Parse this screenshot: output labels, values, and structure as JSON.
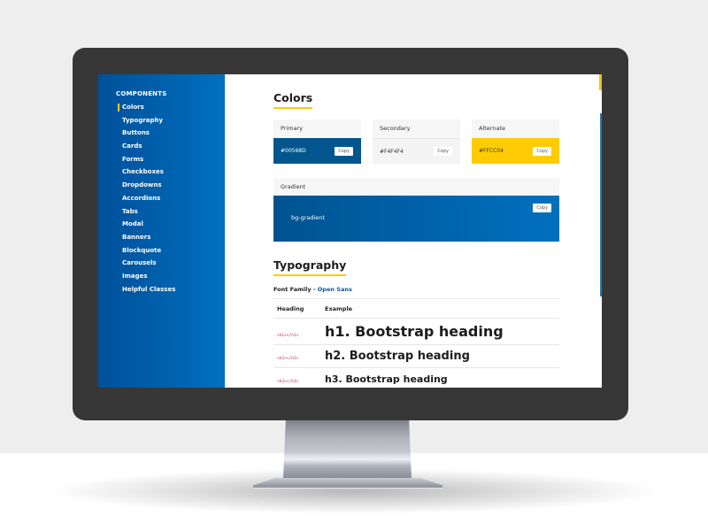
{
  "sidebar": {
    "heading": "COMPONENTS",
    "items": [
      {
        "label": "Colors",
        "active": true
      },
      {
        "label": "Typography"
      },
      {
        "label": "Buttons"
      },
      {
        "label": "Cards"
      },
      {
        "label": "Forms"
      },
      {
        "label": "Checkboxes"
      },
      {
        "label": "Dropdowns"
      },
      {
        "label": "Accordions"
      },
      {
        "label": "Tabs"
      },
      {
        "label": "Modal"
      },
      {
        "label": "Banners"
      },
      {
        "label": "Blockquote"
      },
      {
        "label": "Carousels"
      },
      {
        "label": "Images"
      },
      {
        "label": "Helpful Classes"
      }
    ]
  },
  "colors": {
    "title": "Colors",
    "swatches": [
      {
        "name": "Primary",
        "hex": "#00568D",
        "copy_label": "Copy"
      },
      {
        "name": "Secondary",
        "hex": "#F4F4F4",
        "copy_label": "Copy"
      },
      {
        "name": "Alternate",
        "hex": "#FFCC04",
        "copy_label": "Copy"
      }
    ],
    "gradient": {
      "name": "Gradient",
      "class_name": "bg-gradient",
      "copy_label": "Copy"
    }
  },
  "typography": {
    "title": "Typography",
    "font_family_label": "Font Family - ",
    "font_family_value": "Open Sans",
    "table": {
      "headers": [
        "Heading",
        "Example"
      ],
      "rows": [
        {
          "tag": "<h1></h1>",
          "example": "h1. Bootstrap heading"
        },
        {
          "tag": "<h2></h2>",
          "example": "h2. Bootstrap heading"
        },
        {
          "tag": "<h3></h3>",
          "example": "h3. Bootstrap heading"
        }
      ]
    }
  },
  "theme": {
    "primary": "#00568D",
    "secondary": "#F4F4F4",
    "alternate": "#FFCC04"
  }
}
